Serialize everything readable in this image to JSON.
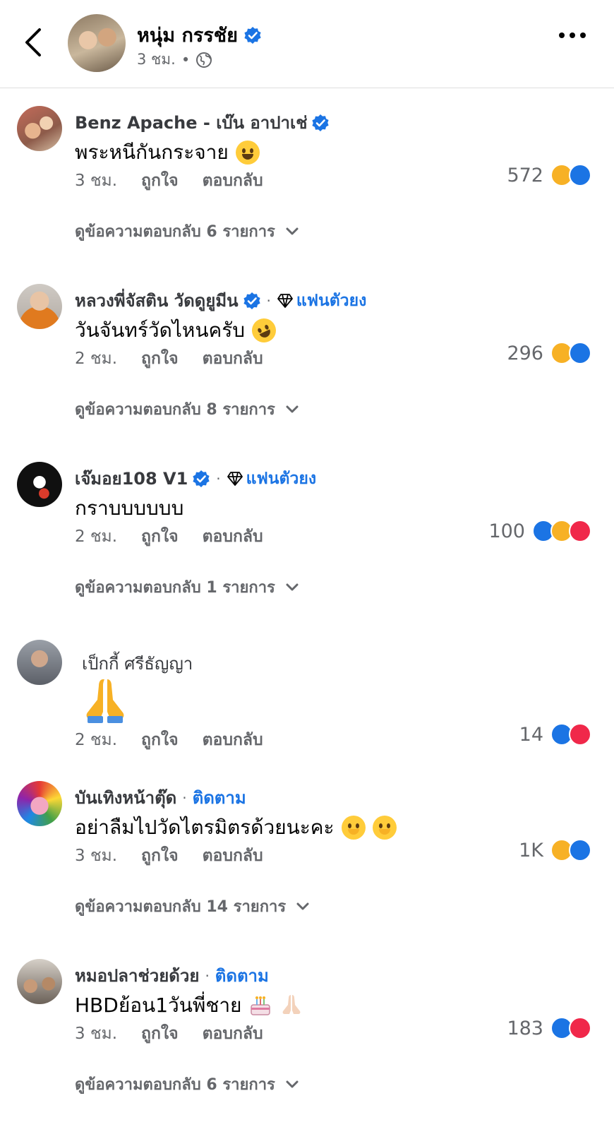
{
  "header": {
    "author": "หนุ่ม กรรชัย",
    "time": "3 ชม.",
    "separator": "•"
  },
  "labels": {
    "like": "ถูกใจ",
    "reply": "ตอบกลับ",
    "fan_badge": "แฟนตัวยง",
    "follow": "ติดตาม"
  },
  "comments": [
    {
      "name": "Benz Apache - เบ๊น อาปาเช่",
      "text": "พระหนีกันกระจาย",
      "time": "3 ชม.",
      "reactions": "572",
      "reaction_icons": [
        "haha-icon",
        "like-icon"
      ],
      "replies": "ดูข้อความตอบกลับ 6 รายการ"
    },
    {
      "name": "หลวงพี่จัสติน วัดดูยูมีน",
      "text": "วันจันทร์วัดไหนครับ",
      "time": "2 ชม.",
      "reactions": "296",
      "reaction_icons": [
        "haha-icon",
        "like-icon"
      ],
      "replies": "ดูข้อความตอบกลับ 8 รายการ"
    },
    {
      "name": "เจ๊มอย108 V1",
      "text": "กราบบบบบบ",
      "time": "2 ชม.",
      "reactions": "100",
      "reaction_icons": [
        "like-icon",
        "haha-icon",
        "love-icon"
      ],
      "replies": "ดูข้อความตอบกลับ 1 รายการ"
    },
    {
      "name": "เป็กกี้ ศรีธัญญา",
      "text": "",
      "time": "2 ชม.",
      "reactions": "14",
      "reaction_icons": [
        "like-icon",
        "love-icon"
      ],
      "replies": ""
    },
    {
      "name": "บันเทิงหน้าตุ๊ด",
      "text": "อย่าลืมไปวัดไตรมิตรด้วยนะคะ",
      "time": "3 ชม.",
      "reactions": "1K",
      "reaction_icons": [
        "haha-icon",
        "like-icon"
      ],
      "replies": "ดูข้อความตอบกลับ 14 รายการ"
    },
    {
      "name": "หมอปลาช่วยด้วย",
      "text": "HBDย้อน1วันพี่ชาย",
      "time": "3 ชม.",
      "reactions": "183",
      "reaction_icons": [
        "like-icon",
        "love-icon"
      ],
      "replies": "ดูข้อความตอบกลับ 6 รายการ"
    }
  ]
}
